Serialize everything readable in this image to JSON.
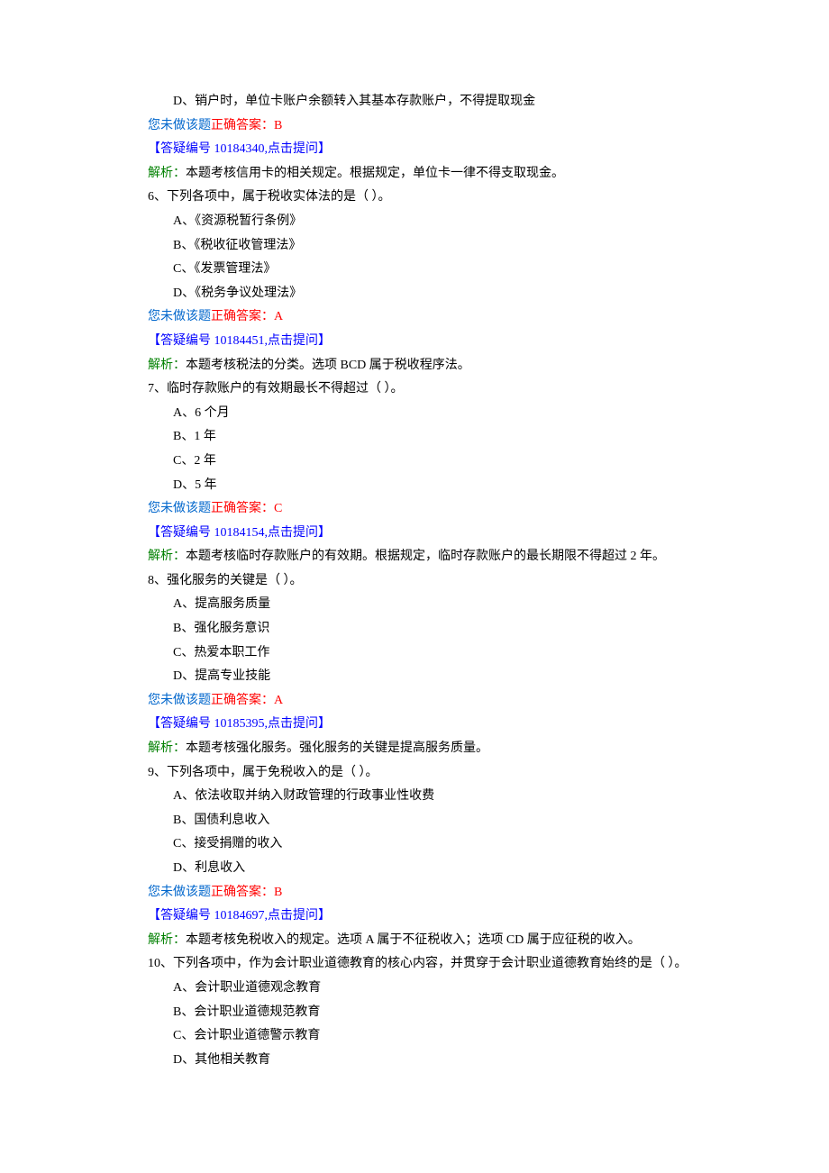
{
  "questions": [
    {
      "option_d": "D、销户时，单位卡账户余额转入其基本存款账户，不得提取现金",
      "status": "您未做该题",
      "answer_label": "正确答案：",
      "answer": "B",
      "qa_link": "【答疑编号 10184340,点击提问】",
      "analysis_label": "解析：",
      "analysis": "本题考核信用卡的相关规定。根据规定，单位卡一律不得支取现金。"
    },
    {
      "stem": "6、下列各项中，属于税收实体法的是（ ）。",
      "options": [
        "A、《资源税暂行条例》",
        "B、《税收征收管理法》",
        "C、《发票管理法》",
        "D、《税务争议处理法》"
      ],
      "status": "您未做该题",
      "answer_label": "正确答案：",
      "answer": "A",
      "qa_link": "【答疑编号 10184451,点击提问】",
      "analysis_label": "解析：",
      "analysis": "本题考核税法的分类。选项 BCD 属于税收程序法。"
    },
    {
      "stem": "7、临时存款账户的有效期最长不得超过（ ）。",
      "options": [
        "A、6 个月",
        "B、1 年",
        "C、2 年",
        "D、5 年"
      ],
      "status": "您未做该题",
      "answer_label": "正确答案：",
      "answer": "C",
      "qa_link": "【答疑编号 10184154,点击提问】",
      "analysis_label": "解析：",
      "analysis": "本题考核临时存款账户的有效期。根据规定，临时存款账户的最长期限不得超过 2 年。"
    },
    {
      "stem": "8、强化服务的关键是（ ）。",
      "options": [
        "A、提高服务质量",
        "B、强化服务意识",
        "C、热爱本职工作",
        "D、提高专业技能"
      ],
      "status": "您未做该题",
      "answer_label": "正确答案：",
      "answer": "A",
      "qa_link": "【答疑编号 10185395,点击提问】",
      "analysis_label": "解析：",
      "analysis": "本题考核强化服务。强化服务的关键是提高服务质量。"
    },
    {
      "stem": "9、下列各项中，属于免税收入的是（ ）。",
      "options": [
        "A、依法收取并纳入财政管理的行政事业性收费",
        "B、国债利息收入",
        "C、接受捐赠的收入",
        "D、利息收入"
      ],
      "status": "您未做该题",
      "answer_label": "正确答案：",
      "answer": "B",
      "qa_link": "【答疑编号 10184697,点击提问】",
      "analysis_label": "解析：",
      "analysis": "本题考核免税收入的规定。选项 A 属于不征税收入；选项 CD 属于应征税的收入。"
    },
    {
      "stem": "10、下列各项中，作为会计职业道德教育的核心内容，并贯穿于会计职业道德教育始终的是（ ）。",
      "options": [
        "A、会计职业道德观念教育",
        "B、会计职业道德规范教育",
        "C、会计职业道德警示教育",
        "D、其他相关教育"
      ]
    }
  ]
}
